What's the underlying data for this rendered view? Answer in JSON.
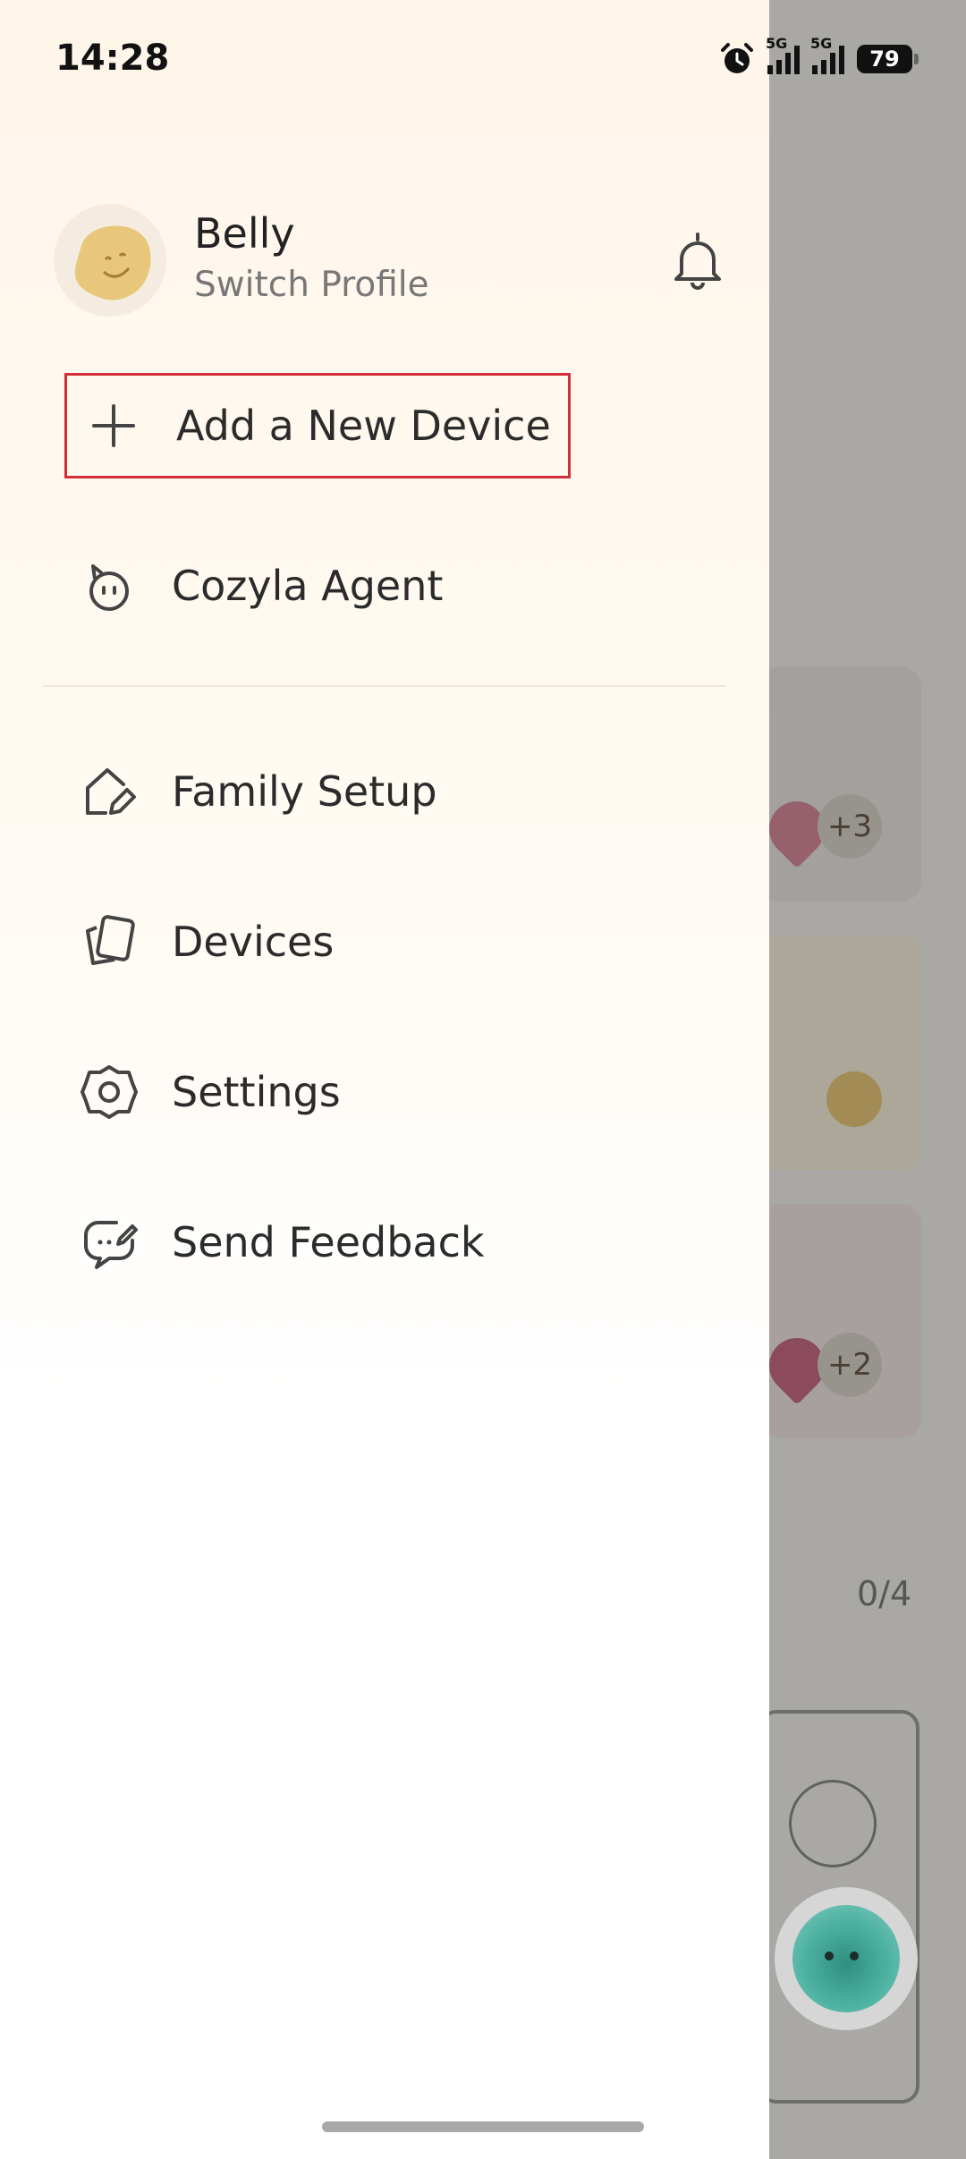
{
  "status_bar": {
    "time": "14:28",
    "signal1_label": "5G",
    "signal2_label": "5G",
    "battery": "79"
  },
  "profile": {
    "name": "Belly",
    "switch_label": "Switch Profile"
  },
  "menu": {
    "add_device": "Add a New Device",
    "agent": "Cozyla Agent",
    "family_setup": "Family Setup",
    "devices": "Devices",
    "settings": "Settings",
    "feedback": "Send Feedback"
  },
  "background": {
    "card1_extra": "+3",
    "card3_extra": "+2",
    "count": "0/4"
  },
  "colors": {
    "highlight_border": "#d32f3a",
    "drawer_top": "#fff6ea",
    "avatar_yellow": "#e8c77a"
  }
}
